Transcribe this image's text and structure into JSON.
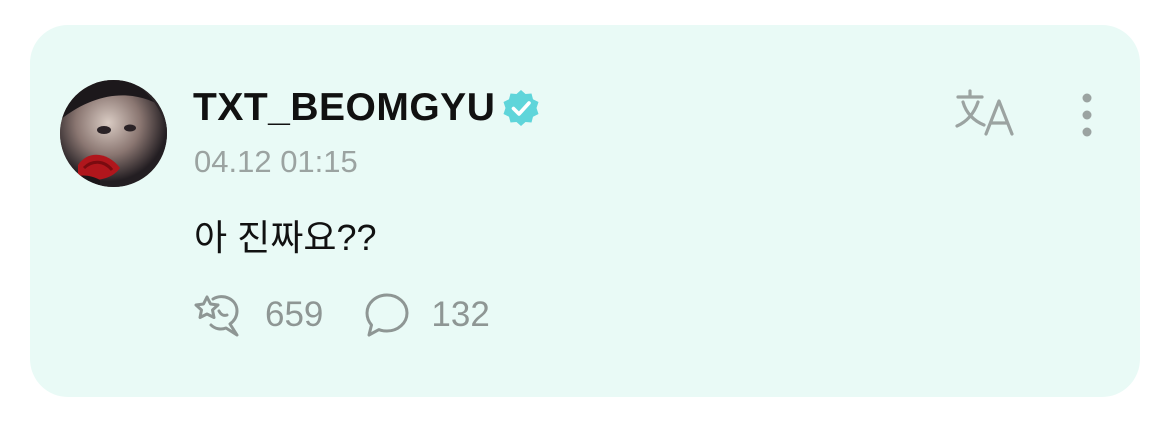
{
  "post": {
    "author": "TXT_BEOMGYU",
    "timestamp": "04.12 01:15",
    "message": "아 진짜요??",
    "like_count": "659",
    "comment_count": "132"
  },
  "icons": {
    "verified": "verified-badge-icon",
    "translate": "translate-icon",
    "more": "more-vertical-icon",
    "like": "reaction-icon",
    "comment": "comment-bubble-icon"
  },
  "colors": {
    "card_background": "#e9faf6",
    "verified_badge": "#5fd5da",
    "muted_text": "#9ba3a1",
    "icon": "#8e9694"
  }
}
